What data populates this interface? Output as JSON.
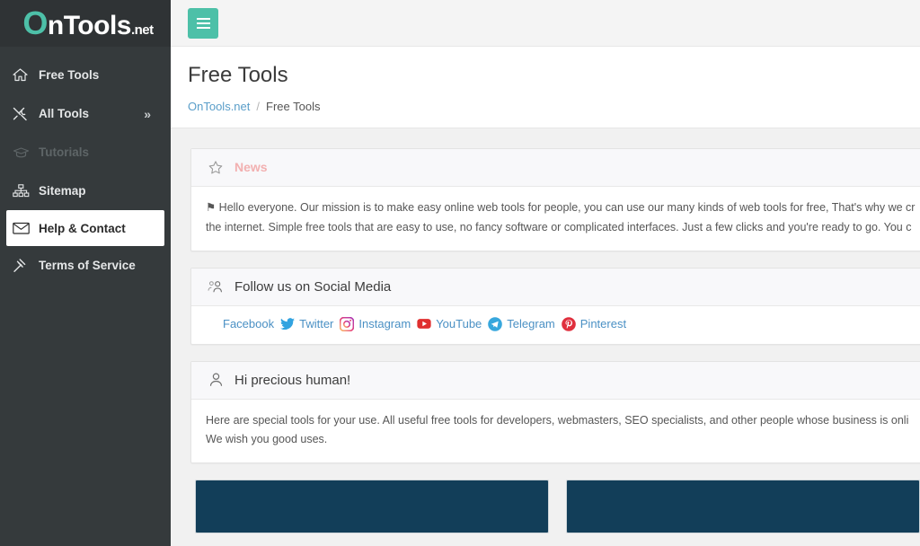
{
  "brand": {
    "logo_first": "O",
    "logo_main": "nTools",
    "logo_tld": ".net",
    "accent_color": "#4dc0a8"
  },
  "sidebar": {
    "items": [
      {
        "label": "Free Tools",
        "icon": "home-icon",
        "state": "normal"
      },
      {
        "label": "All Tools",
        "icon": "tools-icon",
        "state": "normal",
        "chevron": "»"
      },
      {
        "label": "Tutorials",
        "icon": "graduation-cap-icon",
        "state": "disabled"
      },
      {
        "label": "Sitemap",
        "icon": "sitemap-icon",
        "state": "normal"
      },
      {
        "label": "Help & Contact",
        "icon": "envelope-icon",
        "state": "active"
      },
      {
        "label": "Terms of Service",
        "icon": "gavel-icon",
        "state": "normal"
      }
    ]
  },
  "topbar": {
    "menu_toggle_label": "Toggle navigation"
  },
  "page": {
    "title": "Free Tools",
    "breadcrumb": {
      "root": "OnTools.net",
      "separator": "/",
      "current": "Free Tools"
    }
  },
  "cards": {
    "news": {
      "title": "News",
      "icon": "star-icon",
      "title_color": "#f2b0b0",
      "line1": "⚑ Hello everyone. Our mission is to make easy online web tools for people, you can use our many kinds of web tools for free, That's why we cr",
      "line2": "the internet. Simple free tools that are easy to use, no fancy software or complicated interfaces. Just a few clicks and you're ready to go. You c"
    },
    "social": {
      "title": "Follow us on Social Media",
      "icon": "users-icon",
      "links": [
        {
          "label": "Facebook",
          "icon": "facebook-icon"
        },
        {
          "label": "Twitter",
          "icon": "twitter-icon"
        },
        {
          "label": "Instagram",
          "icon": "instagram-icon"
        },
        {
          "label": "YouTube",
          "icon": "youtube-icon"
        },
        {
          "label": "Telegram",
          "icon": "telegram-icon"
        },
        {
          "label": "Pinterest",
          "icon": "pinterest-icon"
        }
      ]
    },
    "welcome": {
      "title": "Hi precious human!",
      "icon": "user-icon",
      "line1": "Here are special tools for your use. All useful free tools for developers, webmasters, SEO specialists, and other people whose business is onli",
      "line2": "We wish you good uses."
    }
  },
  "tool_cards": [
    {
      "panel_color": "#123e59"
    },
    {
      "panel_color": "#123e59"
    }
  ]
}
